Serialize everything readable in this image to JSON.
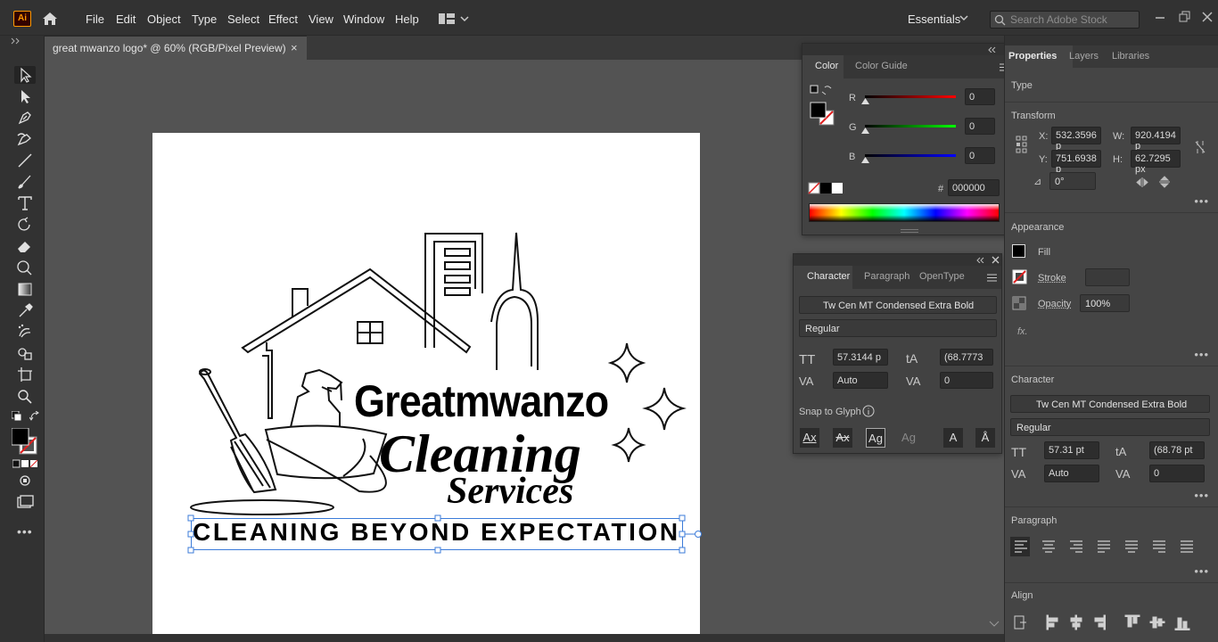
{
  "menubar": {
    "app_badge": "Ai",
    "items": [
      "File",
      "Edit",
      "Object",
      "Type",
      "Select",
      "Effect",
      "View",
      "Window",
      "Help"
    ],
    "workspace": "Essentials",
    "search_placeholder": "Search Adobe Stock"
  },
  "document": {
    "tab_title": "great mwanzo logo* @ 60% (RGB/Pixel Preview)",
    "close": "×"
  },
  "logo": {
    "brand": "Greatmwanzo",
    "line1": "Cleaning",
    "line2": "Services",
    "tagline": "CLEANING BEYOND EXPECTATION"
  },
  "color_panel": {
    "tabs": [
      "Color",
      "Color Guide"
    ],
    "r_label": "R",
    "g_label": "G",
    "b_label": "B",
    "r": "0",
    "g": "0",
    "b": "0",
    "hex_label": "#",
    "hex": "000000"
  },
  "character_panel": {
    "tabs": [
      "Character",
      "Paragraph",
      "OpenType"
    ],
    "font": "Tw Cen MT Condensed Extra Bold",
    "style": "Regular",
    "size": "57.3144 p",
    "leading": "(68.7773",
    "kerning": "Auto",
    "tracking": "0",
    "snap_label": "Snap to Glyph"
  },
  "properties": {
    "tabs": [
      "Properties",
      "Layers",
      "Libraries"
    ],
    "type_label": "Type",
    "transform_label": "Transform",
    "x_label": "X:",
    "x": "532.3596 p",
    "y_label": "Y:",
    "y": "751.6938 p",
    "w_label": "W:",
    "w": "920.4194 p",
    "h_label": "H:",
    "h": "62.7295 px",
    "angle": "0°",
    "appearance_label": "Appearance",
    "fill_label": "Fill",
    "stroke_label": "Stroke",
    "opacity_label": "Opacity",
    "opacity": "100%",
    "fx_label": "fx.",
    "character_label": "Character",
    "char_font": "Tw Cen MT Condensed Extra Bold",
    "char_style": "Regular",
    "char_size": "57.31 pt",
    "char_leading": "(68.78 pt",
    "char_kerning": "Auto",
    "char_tracking": "0",
    "paragraph_label": "Paragraph",
    "align_label": "Align"
  },
  "colors": {
    "panel_bg": "#424242",
    "canvas_bg": "#535353",
    "selection": "#3b7bd9",
    "accent_orange": "#ff9a00"
  }
}
